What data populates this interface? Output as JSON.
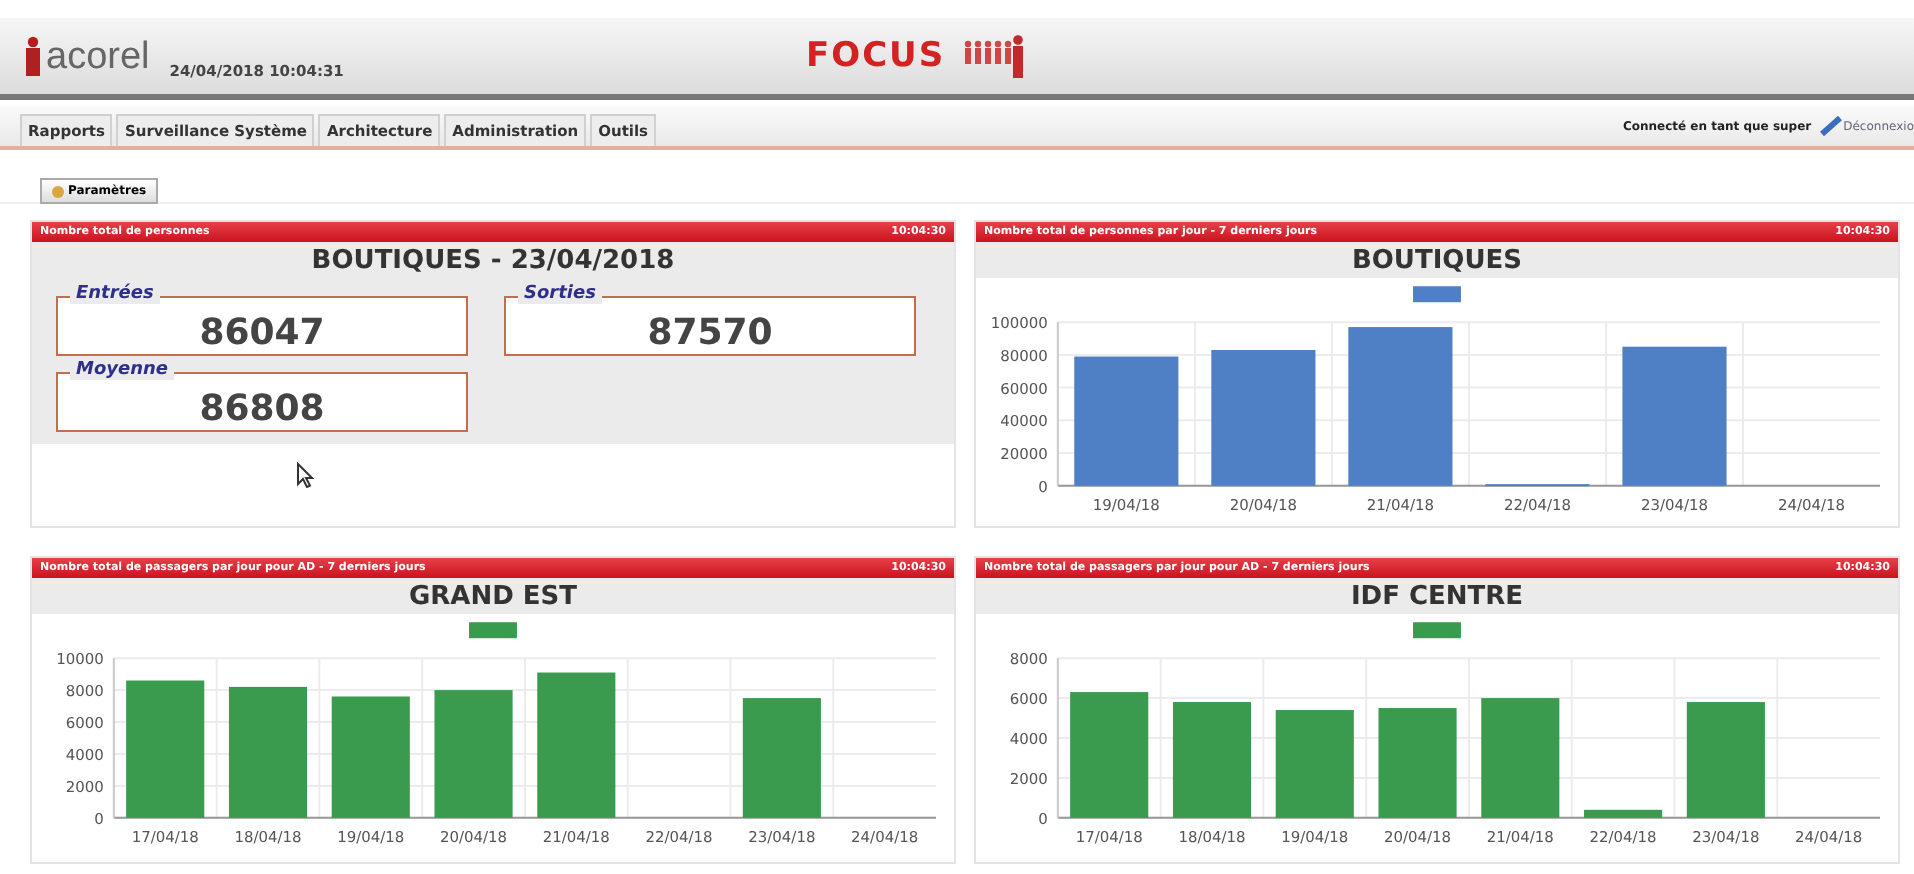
{
  "header": {
    "logo": "acorel",
    "datetime": "24/04/2018 10:04:31",
    "app_title": "FOCUS"
  },
  "menu": {
    "tabs": [
      {
        "label": "Rapports",
        "selected": false
      },
      {
        "label": "Surveillance Système",
        "selected": false
      },
      {
        "label": "Architecture",
        "selected": false
      },
      {
        "label": "Administration",
        "selected": false
      },
      {
        "label": "Outils",
        "selected": false
      }
    ],
    "user_text": "Connecté en tant que super",
    "logout": "Déconnexio"
  },
  "subtabs": [
    {
      "label": "Paramètres",
      "selected": true
    }
  ],
  "panels": [
    {
      "kind": "kpi",
      "header": "Nombre total de personnes",
      "time": "10:04:30",
      "title": "BOUTIQUES - 23/04/2018",
      "metrics": [
        {
          "label": "Entrées",
          "value": "86047"
        },
        {
          "label": "Sorties",
          "value": "87570"
        },
        {
          "label": "Moyenne",
          "value": "86808"
        }
      ]
    },
    {
      "kind": "chart",
      "header": "Nombre total de personnes par jour - 7 derniers jours",
      "time": "10:04:30",
      "title": "BOUTIQUES",
      "chart_data": {
        "type": "bar",
        "categories": [
          "19/04/18",
          "20/04/18",
          "21/04/18",
          "22/04/18",
          "23/04/18",
          "24/04/18"
        ],
        "series": [
          {
            "color": "#4f7fc4",
            "values": [
              79000,
              83000,
              97000,
              1000,
              85000,
              null
            ]
          }
        ],
        "grid": true,
        "ylim": [
          0,
          100000
        ],
        "yticks": [
          0,
          20000,
          40000,
          60000,
          80000,
          100000
        ]
      }
    },
    {
      "kind": "chart",
      "header": "Nombre total de passagers par jour pour AD - 7 derniers jours",
      "time": "10:04:30",
      "title": "GRAND EST",
      "chart_data": {
        "type": "bar",
        "categories": [
          "17/04/18",
          "18/04/18",
          "19/04/18",
          "20/04/18",
          "21/04/18",
          "22/04/18",
          "23/04/18",
          "24/04/18"
        ],
        "series": [
          {
            "color": "#3a9a4e",
            "values": [
              8600,
              8200,
              7600,
              8000,
              9100,
              null,
              7500,
              null
            ]
          }
        ],
        "grid": true,
        "ylim": [
          0,
          10000
        ],
        "yticks": [
          0,
          2000,
          4000,
          6000,
          8000,
          10000
        ]
      }
    },
    {
      "kind": "chart",
      "header": "Nombre total de passagers par jour pour AD - 7 derniers jours",
      "time": "10:04:30",
      "title": "IDF CENTRE",
      "chart_data": {
        "type": "bar",
        "categories": [
          "17/04/18",
          "18/04/18",
          "19/04/18",
          "20/04/18",
          "21/04/18",
          "22/04/18",
          "23/04/18",
          "24/04/18"
        ],
        "series": [
          {
            "color": "#3a9a4e",
            "values": [
              6300,
              5800,
              5400,
              5500,
              6000,
              400,
              5800,
              null
            ]
          }
        ],
        "grid": true,
        "ylim": [
          0,
          8000
        ],
        "yticks": [
          0,
          2000,
          4000,
          6000,
          8000
        ]
      }
    }
  ]
}
